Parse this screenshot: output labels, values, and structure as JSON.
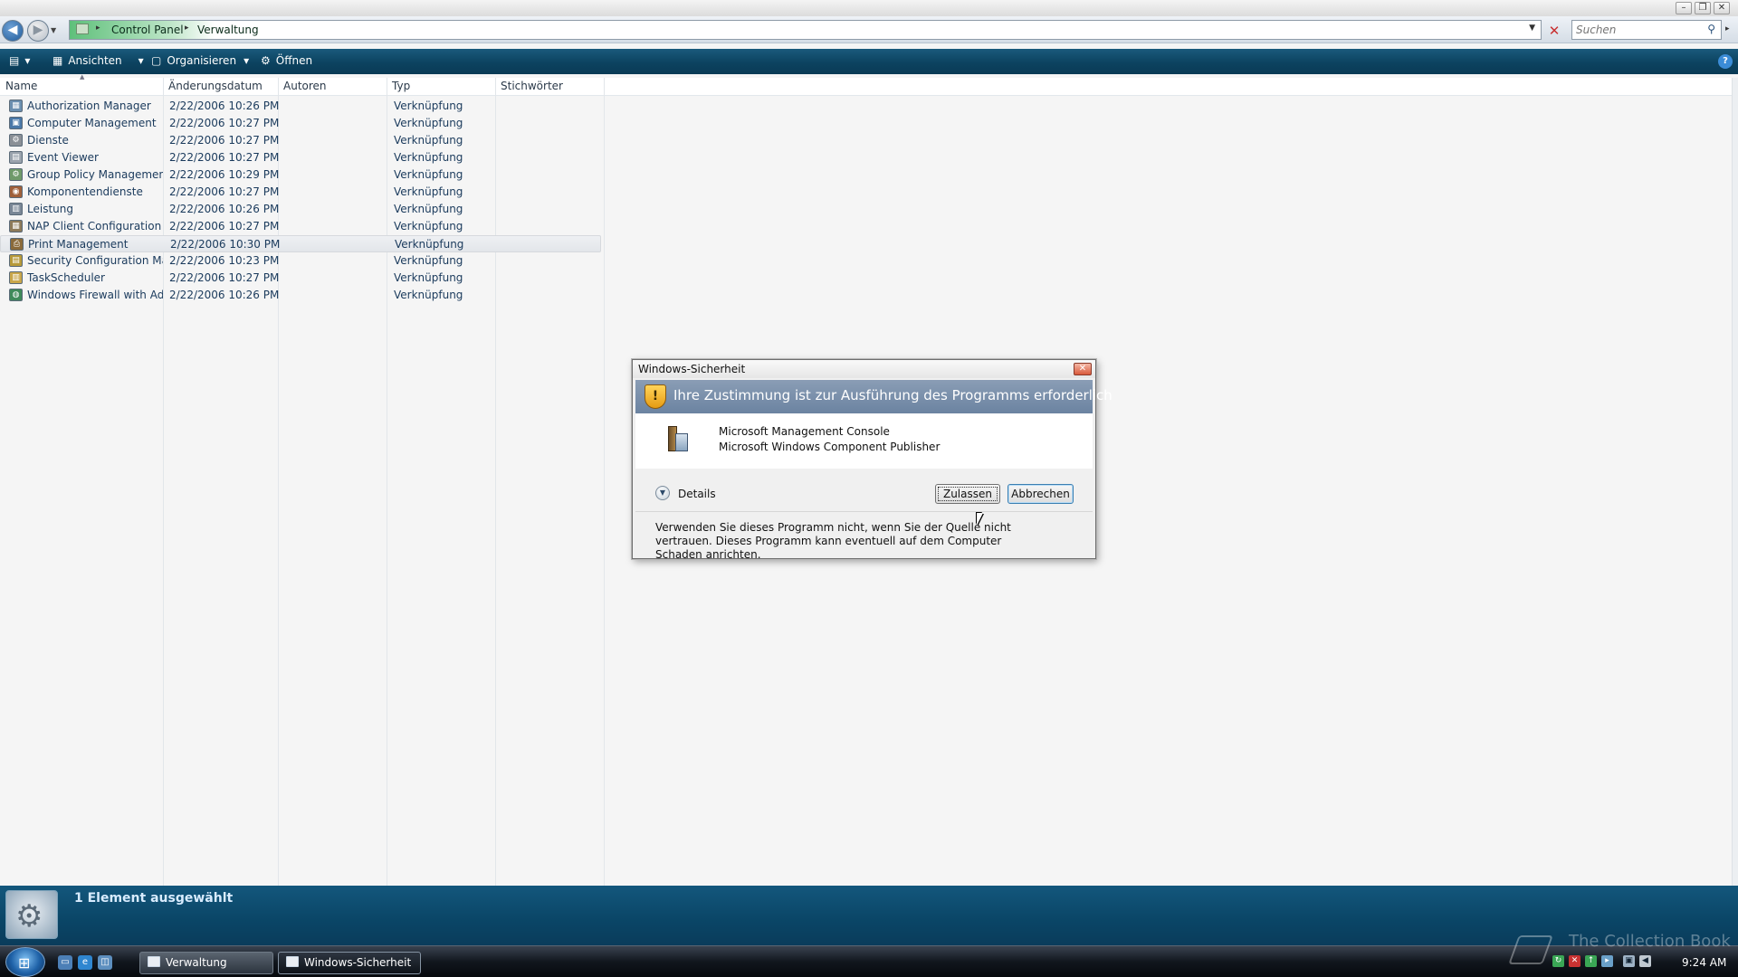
{
  "breadcrumb": {
    "items": [
      "Control Panel",
      "Verwaltung"
    ]
  },
  "search": {
    "placeholder": "Suchen"
  },
  "toolbar": {
    "views_label": "Ansichten",
    "organize_label": "Organisieren",
    "open_label": "Öffnen"
  },
  "columns": [
    "Name",
    "Änderungsdatum",
    "Autoren",
    "Typ",
    "Stichwörter"
  ],
  "files": [
    {
      "name": "Authorization Manager",
      "date": "2/22/2006 10:26 PM",
      "authors": "",
      "type": "Verknüpfung",
      "icon": "authorization-icon"
    },
    {
      "name": "Computer Management",
      "date": "2/22/2006 10:27 PM",
      "authors": "",
      "type": "Verknüpfung",
      "icon": "computer-management-icon"
    },
    {
      "name": "Dienste",
      "date": "2/22/2006 10:27 PM",
      "authors": "",
      "type": "Verknüpfung",
      "icon": "services-icon"
    },
    {
      "name": "Event Viewer",
      "date": "2/22/2006 10:27 PM",
      "authors": "",
      "type": "Verknüpfung",
      "icon": "event-viewer-icon"
    },
    {
      "name": "Group Policy Management",
      "date": "2/22/2006 10:29 PM",
      "authors": "",
      "type": "Verknüpfung",
      "icon": "group-policy-icon"
    },
    {
      "name": "Komponentendienste",
      "date": "2/22/2006 10:27 PM",
      "authors": "",
      "type": "Verknüpfung",
      "icon": "component-services-icon"
    },
    {
      "name": "Leistung",
      "date": "2/22/2006 10:26 PM",
      "authors": "",
      "type": "Verknüpfung",
      "icon": "performance-icon"
    },
    {
      "name": "NAP Client Configuration",
      "date": "2/22/2006 10:27 PM",
      "authors": "",
      "type": "Verknüpfung",
      "icon": "nap-client-icon"
    },
    {
      "name": "Print Management",
      "date": "2/22/2006 10:30 PM",
      "authors": "",
      "type": "Verknüpfung",
      "icon": "print-management-icon",
      "selected": true
    },
    {
      "name": "Security Configuration Ma...",
      "date": "2/22/2006 10:23 PM",
      "authors": "",
      "type": "Verknüpfung",
      "icon": "security-config-icon"
    },
    {
      "name": "TaskScheduler",
      "date": "2/22/2006 10:27 PM",
      "authors": "",
      "type": "Verknüpfung",
      "icon": "task-scheduler-icon"
    },
    {
      "name": "Windows Firewall with Ad...",
      "date": "2/22/2006 10:26 PM",
      "authors": "",
      "type": "Verknüpfung",
      "icon": "firewall-icon"
    }
  ],
  "details_pane": {
    "status": "1 Element ausgewählt"
  },
  "dialog": {
    "title": "Windows-Sicherheit",
    "headline": "Ihre Zustimmung ist zur Ausführung des Programms erforderlich",
    "program_name": "Microsoft Management Console",
    "publisher": "Microsoft Windows Component Publisher",
    "details_label": "Details",
    "allow_label": "Zulassen",
    "cancel_label": "Abbrechen",
    "warning": "Verwenden Sie dieses Programm nicht, wenn Sie der Quelle nicht vertrauen. Dieses Programm kann eventuell auf dem Computer Schaden anrichten."
  },
  "taskbar": {
    "buttons": [
      "Verwaltung",
      "Windows-Sicherheit"
    ],
    "clock": "9:24 AM"
  },
  "watermark": "The Collection Book",
  "colors": {
    "toolbar": "#0c4360",
    "details_pane": "#0a4566",
    "dialog_banner": "#7a90ab",
    "link_text": "#1a3a5c"
  }
}
